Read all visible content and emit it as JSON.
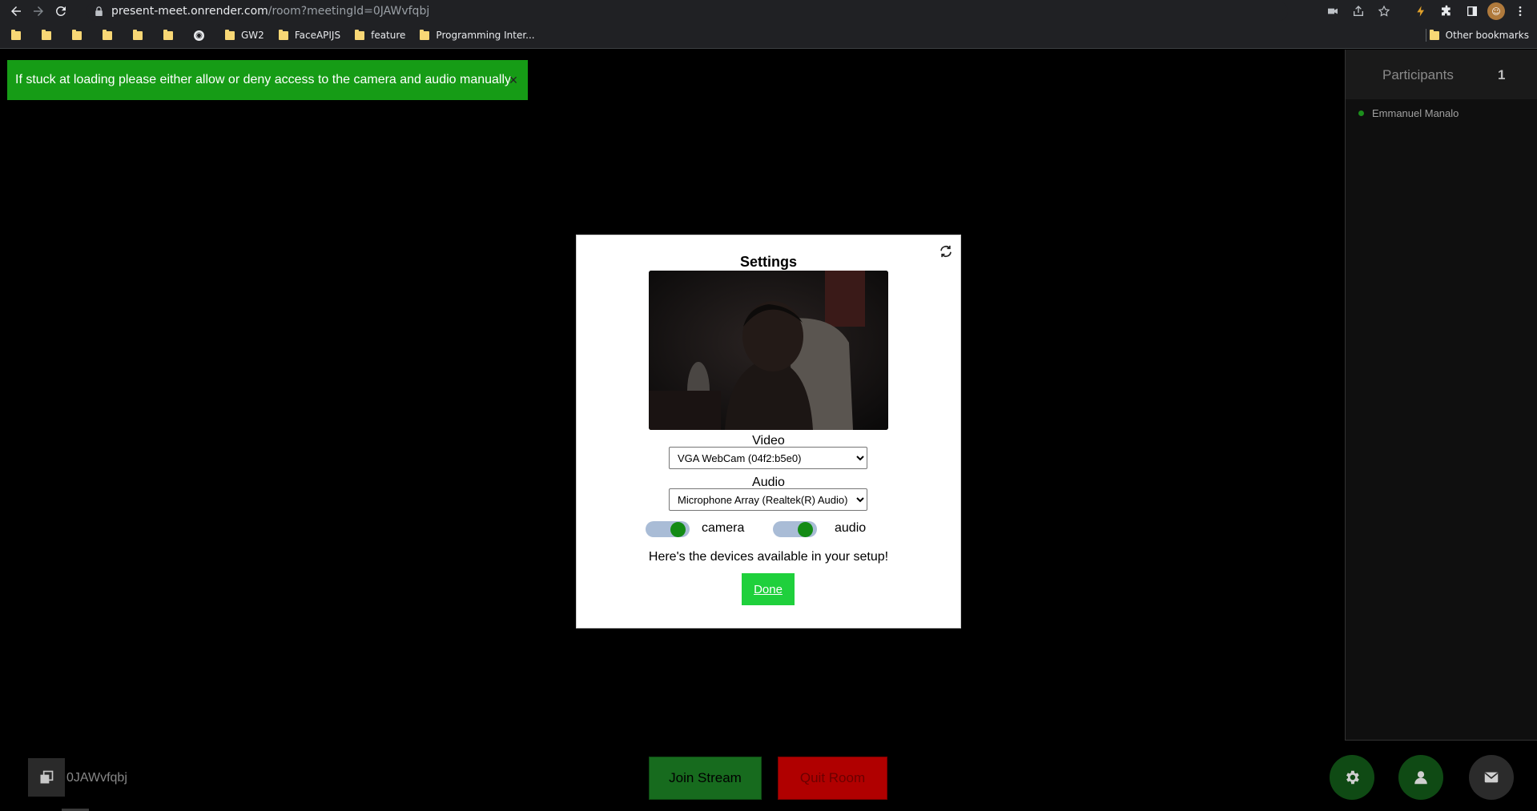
{
  "browser": {
    "url_host": "present-meet.onrender.com",
    "url_path": "/room?meetingId=0JAWvfqbj",
    "bookmarks": [
      "",
      "",
      "",
      "",
      "",
      "",
      "",
      "GW2",
      "FaceAPIJS",
      "feature",
      "Programming Inter..."
    ],
    "other_bookmarks": "Other bookmarks"
  },
  "toast": {
    "text": "If stuck at loading please either allow or deny access to the camera and audio manually",
    "close": "×"
  },
  "participants": {
    "title": "Participants",
    "count": "1",
    "list": [
      {
        "name": "Emmanuel Manalo",
        "status_color": "#1c8f1c"
      }
    ]
  },
  "settings": {
    "title": "Settings",
    "video_label": "Video",
    "video_selected": "VGA WebCam (04f2:b5e0)",
    "audio_label": "Audio",
    "audio_selected": "Microphone Array (Realtek(R) Audio)",
    "camera_toggle_label": "camera",
    "audio_toggle_label": "audio",
    "camera_on": true,
    "audio_on": true,
    "hint": "Here's the devices available in your setup!",
    "done": "Done"
  },
  "footer": {
    "room_id": "0JAWvfqbj",
    "join": "Join Stream",
    "quit": "Quit Room"
  },
  "colors": {
    "toast_bg": "#169c16",
    "done_bg": "#1fd03c",
    "join_bg": "#176b1e",
    "quit_bg": "#b00000",
    "toggle_on": "#138b15"
  },
  "icons": {
    "back": "arrow-left-icon",
    "forward": "arrow-right-icon",
    "reload": "reload-icon",
    "settings": "gear-icon",
    "profile": "person-icon",
    "messages": "envelope-icon",
    "copy": "copy-icon",
    "refresh_devices": "refresh-icon"
  }
}
